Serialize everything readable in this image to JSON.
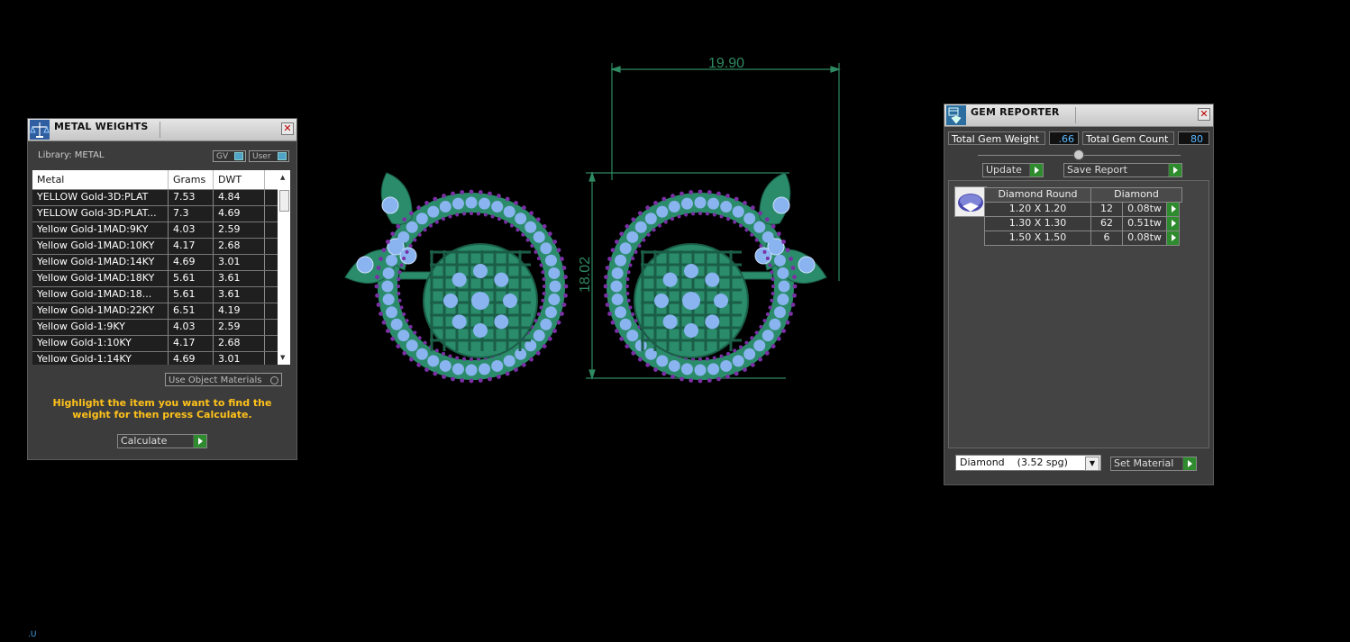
{
  "metal_panel": {
    "title": "METAL WEIGHTS",
    "library_label": "Library: METAL",
    "toggle_gv": "GV",
    "toggle_user": "User",
    "columns": [
      "Metal",
      "Grams",
      "DWT"
    ],
    "rows": [
      [
        "YELLOW Gold-3D:PLAT",
        "7.53",
        "4.84"
      ],
      [
        "YELLOW Gold-3D:PLAT...",
        "7.3",
        "4.69"
      ],
      [
        "Yellow Gold-1MAD:9KY",
        "4.03",
        "2.59"
      ],
      [
        "Yellow Gold-1MAD:10KY",
        "4.17",
        "2.68"
      ],
      [
        "Yellow Gold-1MAD:14KY",
        "4.69",
        "3.01"
      ],
      [
        "Yellow Gold-1MAD:18KY",
        "5.61",
        "3.61"
      ],
      [
        "Yellow Gold-1MAD:18...",
        "5.61",
        "3.61"
      ],
      [
        "Yellow Gold-1MAD:22KY",
        "6.51",
        "4.19"
      ],
      [
        "Yellow Gold-1:9KY",
        "4.03",
        "2.59"
      ],
      [
        "Yellow Gold-1:10KY",
        "4.17",
        "2.68"
      ],
      [
        "Yellow Gold-1:14KY",
        "4.69",
        "3.01"
      ]
    ],
    "use_object_materials": "Use Object Materials",
    "hint": "Highlight the item you want to find the weight for then press Calculate.",
    "calculate_label": "Calculate"
  },
  "viewport": {
    "dim_width": "19.90",
    "dim_height": "18.02",
    "corner_mark": ".U"
  },
  "gem_panel": {
    "title": "GEM REPORTER",
    "total_weight_label": "Total Gem Weight",
    "total_weight_value": ".66",
    "total_count_label": "Total Gem Count",
    "total_count_value": "80",
    "update_label": "Update",
    "save_report_label": "Save Report",
    "table_headers": [
      "Diamond Round",
      "Diamond"
    ],
    "rows": [
      [
        "1.20 X 1.20",
        "12",
        "0.08tw"
      ],
      [
        "1.30 X 1.30",
        "62",
        "0.51tw"
      ],
      [
        "1.50 X 1.50",
        "6",
        "0.08tw"
      ]
    ],
    "material_select": "Diamond    (3.52 spg)",
    "set_material_label": "Set Material"
  },
  "colors": {
    "gem_blue": "#8ab4f0",
    "prong_purple": "#7b2fa5",
    "metal_green": "#2a8c6a",
    "dim_line": "#3fa37a"
  }
}
